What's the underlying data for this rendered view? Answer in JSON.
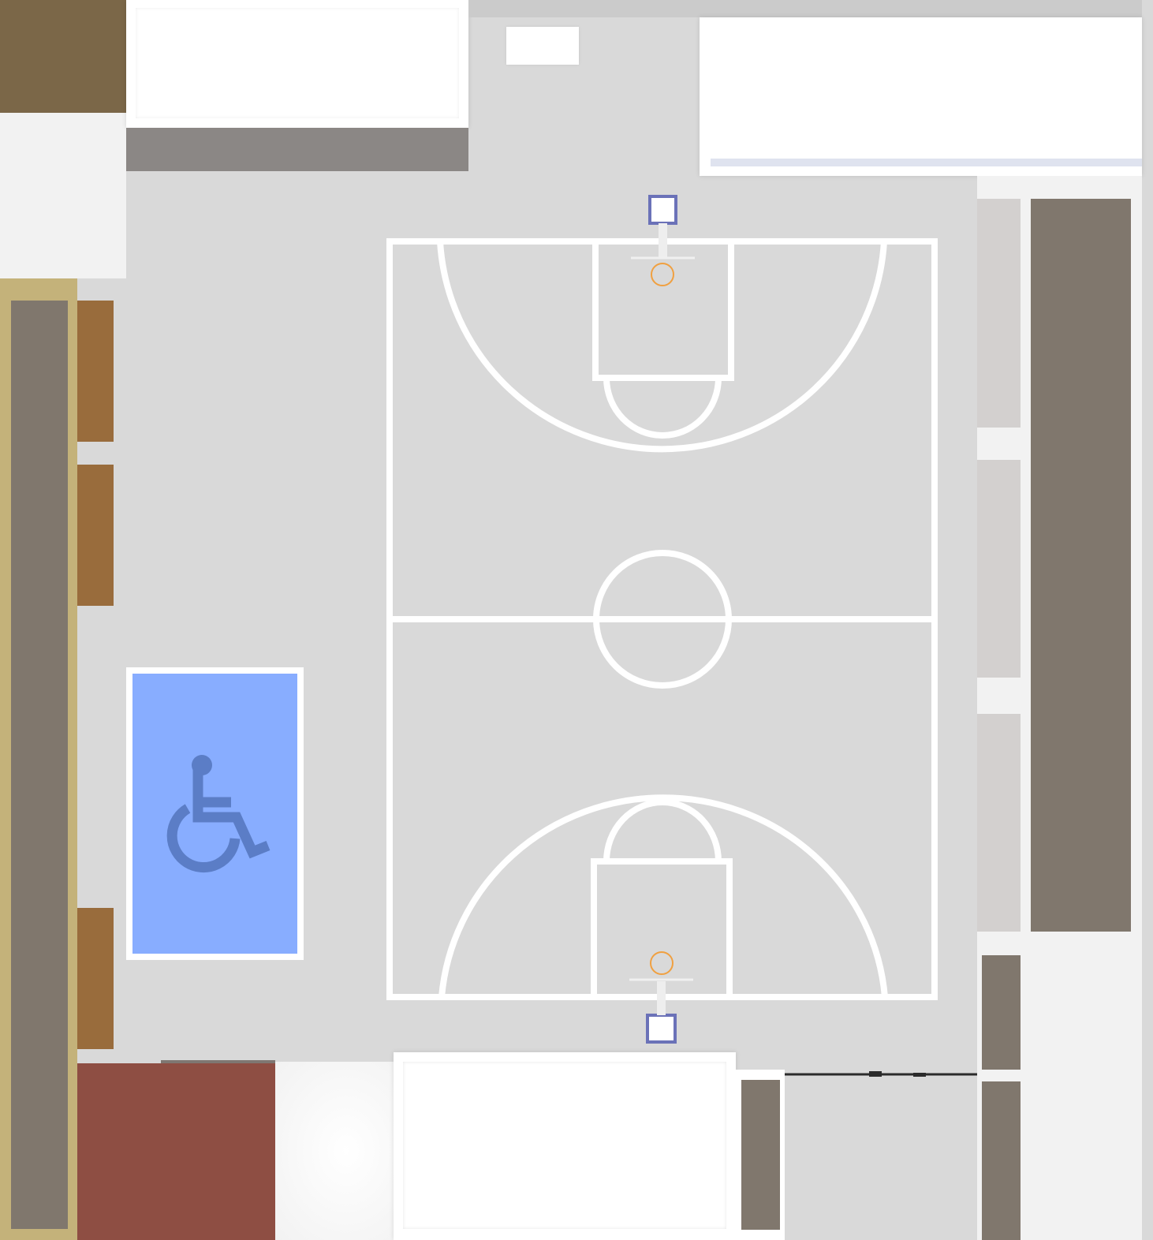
{
  "map": {
    "type": "indoor-facility-floor-plan",
    "features": [
      "basketball-court",
      "accessible-parking-space",
      "buildings",
      "benches"
    ]
  },
  "colors": {
    "ground": "#d9d9d9",
    "building": "#ffffff",
    "building_pale": "#f2f2f2",
    "bleacher": "#80776d",
    "bleacher_light": "#d3d0cf",
    "court_line": "#ffffff",
    "hoop": "#f0a040",
    "backboard_frame": "#6b72b8",
    "accessible_space": "#88adff",
    "accessible_symbol": "#5b7dc6",
    "brick": "#8e4e43",
    "ochre": "#996c3c",
    "tan_border": "#c4b27a"
  },
  "icons": {
    "accessible": "wheelchair-icon",
    "hoop": "basketball-hoop-icon"
  }
}
